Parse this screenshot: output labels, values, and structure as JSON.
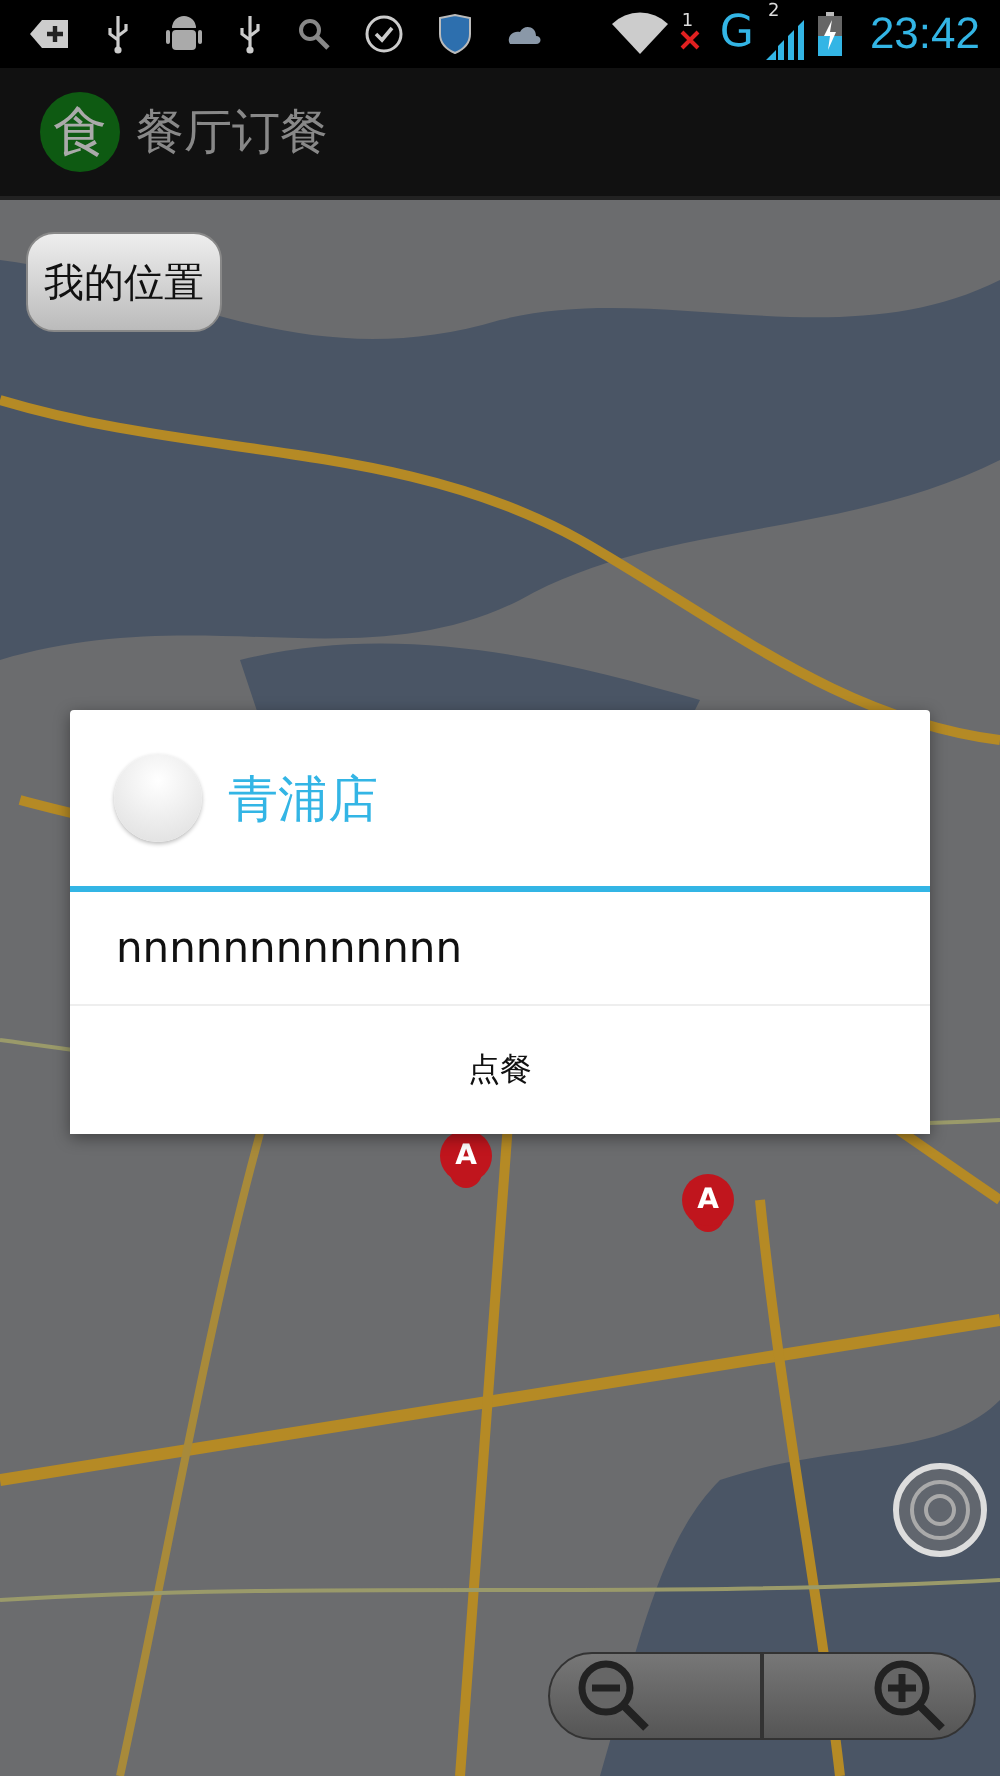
{
  "status_bar": {
    "network": "G",
    "sim_1": "1",
    "sim_2": "2",
    "time": "23:42"
  },
  "action_bar": {
    "logo": "食",
    "title": "餐厅订餐"
  },
  "map": {
    "my_location_button": "我的位置",
    "markers": [
      {
        "label": "A"
      },
      {
        "label": "A"
      }
    ]
  },
  "dialog": {
    "title": "青浦店",
    "message": "nnnnnnnnnnnnn",
    "buttons": [
      "点餐"
    ]
  }
}
